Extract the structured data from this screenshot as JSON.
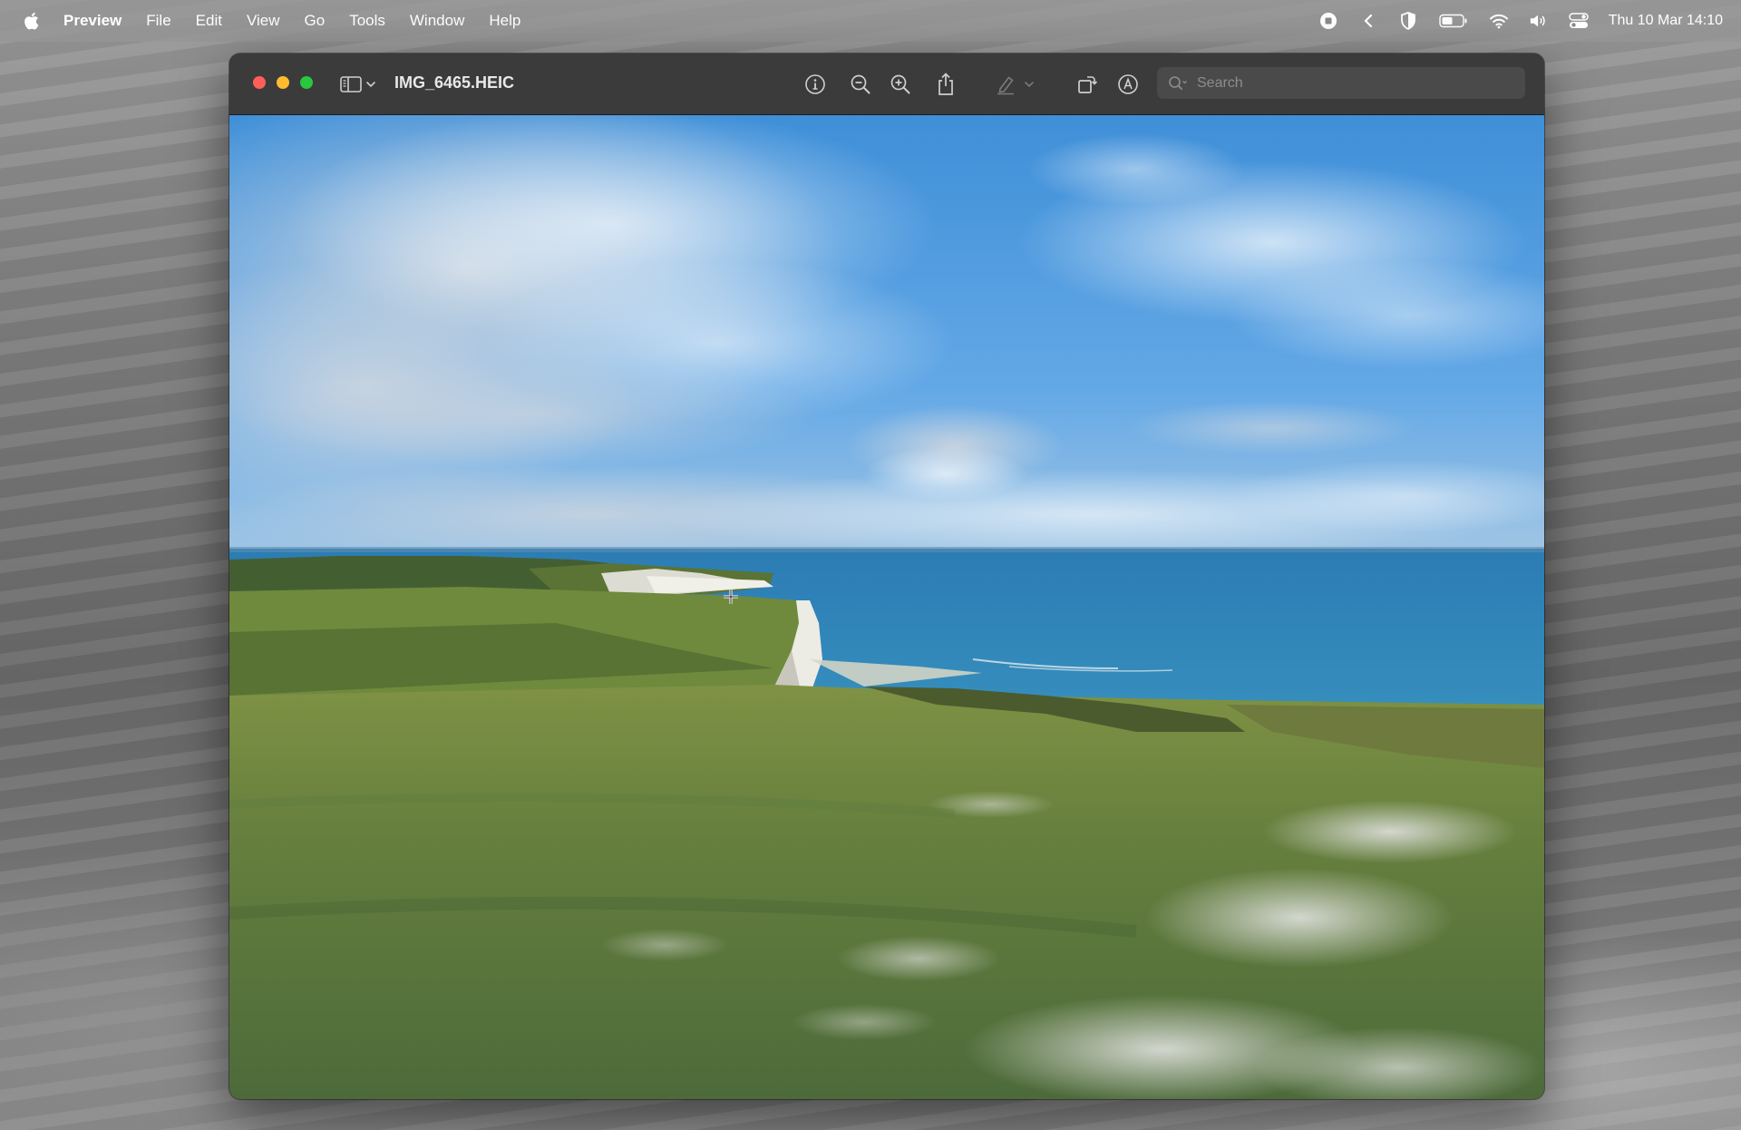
{
  "menubar": {
    "apple_icon": "apple-icon",
    "app_name": "Preview",
    "items": [
      "File",
      "Edit",
      "View",
      "Go",
      "Tools",
      "Window",
      "Help"
    ],
    "status_icons": [
      "screen-record-icon",
      "chevron-left-icon",
      "shield-icon",
      "battery-icon",
      "wifi-icon",
      "volume-icon",
      "control-center-icon"
    ],
    "clock": "Thu 10 Mar  14:10"
  },
  "window": {
    "title": "IMG_6465.HEIC",
    "toolbar_icons": [
      "sidebar-icon",
      "chevron-down-icon",
      "info-icon",
      "zoom-out-icon",
      "zoom-in-icon",
      "share-icon",
      "highlight-icon",
      "chevron-down-icon",
      "rotate-icon",
      "markup-icon"
    ],
    "search": {
      "placeholder": "Search",
      "value": ""
    }
  },
  "colors": {
    "close": "#ff5f57",
    "minimize": "#febc2e",
    "maximize": "#28c840",
    "titlebar": "#3b3b3b"
  }
}
